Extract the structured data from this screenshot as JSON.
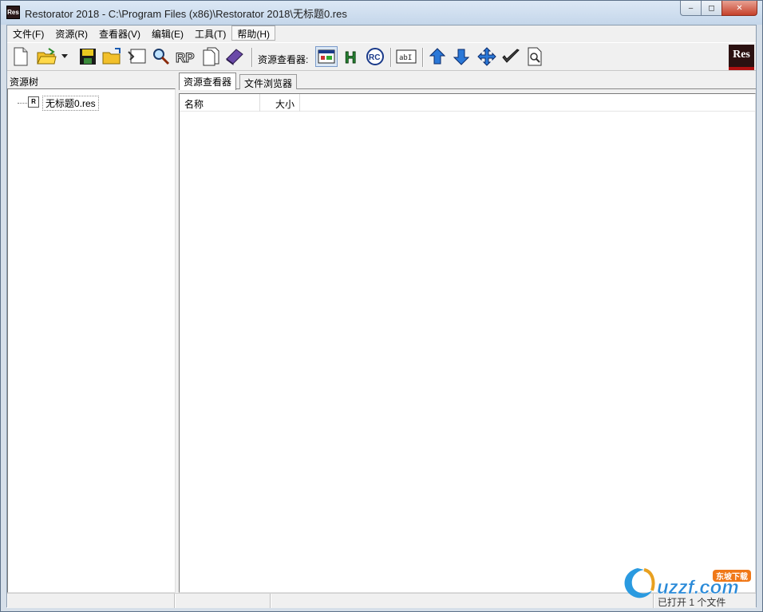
{
  "window": {
    "title": "Restorator 2018 - C:\\Program Files (x86)\\Restorator 2018\\无标题0.res",
    "app_icon_text": "Res",
    "minimize": "‒",
    "maximize": "◻",
    "close": "✕"
  },
  "menu": {
    "items": [
      {
        "label": "文件(F)"
      },
      {
        "label": "资源(R)"
      },
      {
        "label": "查看器(V)"
      },
      {
        "label": "编辑(E)"
      },
      {
        "label": "工具(T)"
      },
      {
        "label": "帮助(H)"
      }
    ]
  },
  "toolbar": {
    "viewer_label": "资源查看器:",
    "logo_text": "Res"
  },
  "tree": {
    "header": "资源树",
    "root_icon_text": "R",
    "root_label": "无标题0.res"
  },
  "tabs": [
    {
      "label": "资源查看器"
    },
    {
      "label": "文件浏览器"
    }
  ],
  "list": {
    "columns": [
      {
        "label": "名称"
      },
      {
        "label": "大小"
      }
    ]
  },
  "status": {
    "cells": [
      "",
      "",
      "",
      "已打开 1 个文件"
    ]
  },
  "watermark": {
    "brand": "uzzf.com",
    "tag": "东坡下载"
  }
}
